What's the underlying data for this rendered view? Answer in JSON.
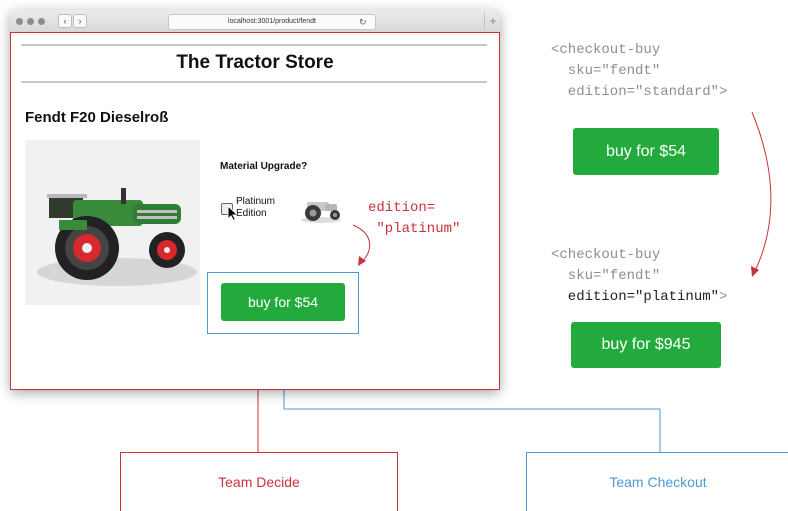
{
  "browser": {
    "url": "localhost:3001/product/fendt",
    "reload_glyph": "↻",
    "back_glyph": "‹",
    "forward_glyph": "›",
    "new_tab_glyph": "+"
  },
  "store": {
    "title": "The Tractor Store",
    "product_name": "Fendt F20 Dieselroß"
  },
  "upgrade": {
    "heading": "Material Upgrade?",
    "option_label": "Platinum Edition"
  },
  "product_buy_button": "buy for $54",
  "annotation": {
    "line1": "edition=",
    "line2": " \"platinum\""
  },
  "code_standard": {
    "line1": "<checkout-buy",
    "line2": "  sku=\"fendt\"",
    "line3": "  edition=\"standard\">",
    "button": "buy for $54"
  },
  "code_platinum": {
    "line1": "<checkout-buy",
    "line2": "  sku=\"fendt\"",
    "line3_attr": "  edition=\"platinum\"",
    "line3_close": ">",
    "button": "buy for $945"
  },
  "teams": {
    "decide": "Team Decide",
    "checkout": "Team Checkout"
  },
  "colors": {
    "team_decide": "#c8323a",
    "team_checkout": "#4a9cd2",
    "button_green": "#22ab3c",
    "code_gray": "#8e8e8e"
  },
  "icons": [
    "mouse-cursor-icon",
    "back-arrow-icon",
    "forward-arrow-icon",
    "reload-icon",
    "plus-icon"
  ]
}
